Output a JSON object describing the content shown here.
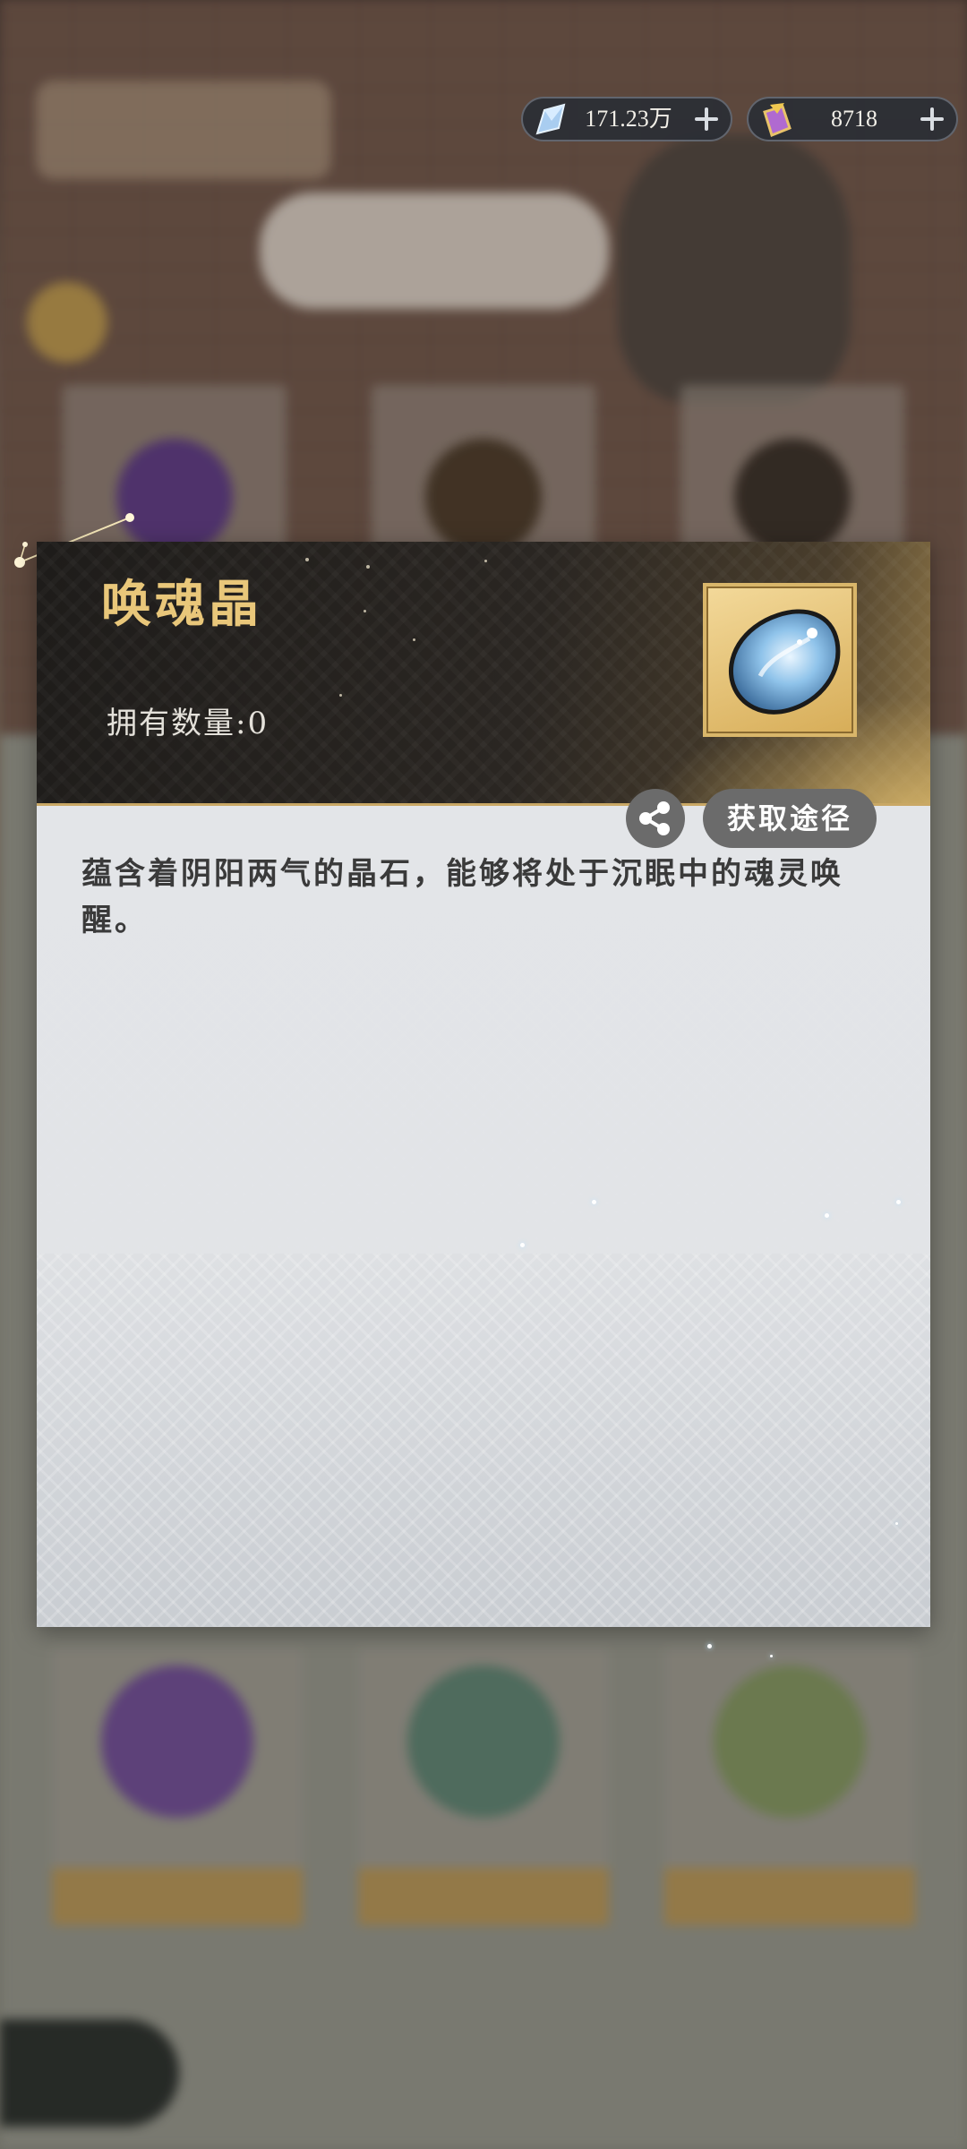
{
  "currency": {
    "jade": {
      "value": "171.23万",
      "icon": "jade-crystal-icon"
    },
    "gem": {
      "value": "8718",
      "icon": "gold-gem-icon"
    }
  },
  "item_panel": {
    "name": "唤魂晶",
    "owned_label": "拥有数量:0",
    "description": "蕴含着阴阳两气的晶石，能够将处于沉眠中的魂灵唤醒。",
    "share_icon": "share-icon",
    "source_button_label": "获取途径",
    "icon": "soul-crystal-icon"
  },
  "colors": {
    "title_gold": "#e9c77a",
    "panel_dark": "#1e1c1a",
    "panel_light": "#e2e4e7",
    "button_gray": "#6b6b6b"
  }
}
